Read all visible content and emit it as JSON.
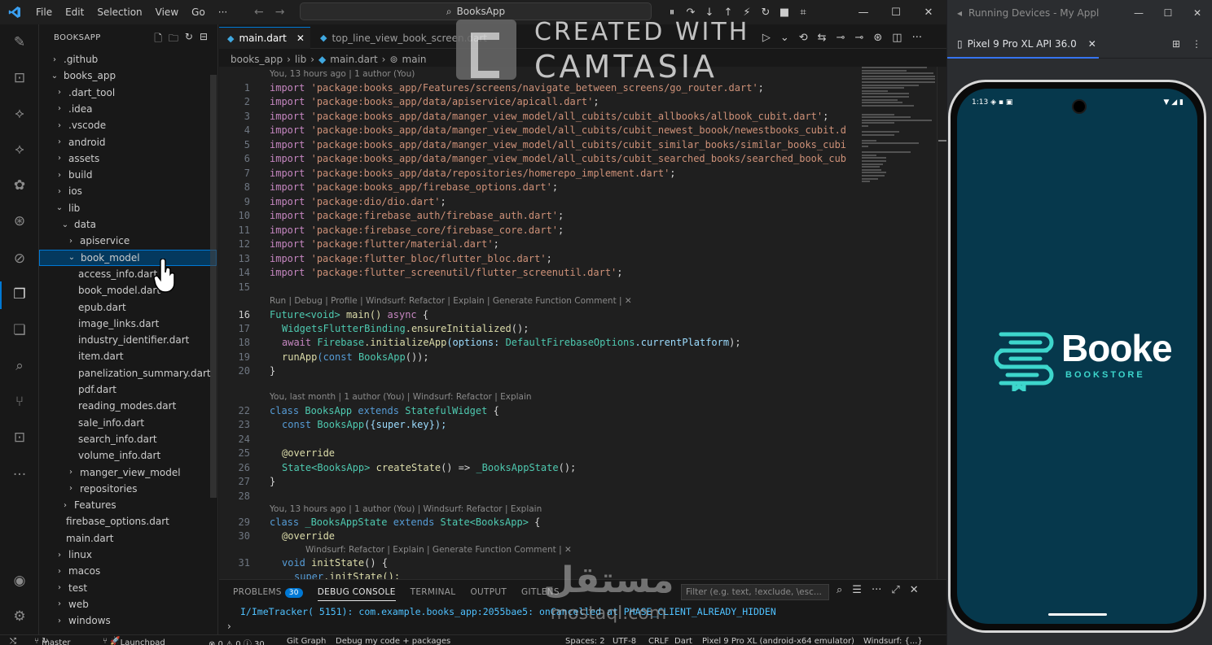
{
  "titlebar": {
    "menus": [
      "File",
      "Edit",
      "Selection",
      "View",
      "Go",
      "···"
    ],
    "search_text": "BooksApp"
  },
  "explorer": {
    "title": "BOOKSAPP",
    "items": [
      {
        "label": ".github",
        "level": 1,
        "chevron": "›"
      },
      {
        "label": "books_app",
        "level": 1,
        "chevron": "⌄"
      },
      {
        "label": ".dart_tool",
        "level": 2,
        "chevron": "›"
      },
      {
        "label": ".idea",
        "level": 2,
        "chevron": "›"
      },
      {
        "label": ".vscode",
        "level": 2,
        "chevron": "›"
      },
      {
        "label": "android",
        "level": 2,
        "chevron": "›"
      },
      {
        "label": "assets",
        "level": 2,
        "chevron": "›"
      },
      {
        "label": "build",
        "level": 2,
        "chevron": "›"
      },
      {
        "label": "ios",
        "level": 2,
        "chevron": "›"
      },
      {
        "label": "lib",
        "level": 2,
        "chevron": "⌄"
      },
      {
        "label": "data",
        "level": 3,
        "chevron": "⌄"
      },
      {
        "label": "apiservice",
        "level": 4,
        "chevron": "›"
      },
      {
        "label": "book_model",
        "level": 4,
        "chevron": "⌄",
        "selected": true
      },
      {
        "label": "access_info.dart",
        "level": 5,
        "chevron": ""
      },
      {
        "label": "book_model.dart",
        "level": 5,
        "chevron": ""
      },
      {
        "label": "epub.dart",
        "level": 5,
        "chevron": ""
      },
      {
        "label": "image_links.dart",
        "level": 5,
        "chevron": ""
      },
      {
        "label": "industry_identifier.dart",
        "level": 5,
        "chevron": ""
      },
      {
        "label": "item.dart",
        "level": 5,
        "chevron": ""
      },
      {
        "label": "panelization_summary.dart",
        "level": 5,
        "chevron": ""
      },
      {
        "label": "pdf.dart",
        "level": 5,
        "chevron": ""
      },
      {
        "label": "reading_modes.dart",
        "level": 5,
        "chevron": ""
      },
      {
        "label": "sale_info.dart",
        "level": 5,
        "chevron": ""
      },
      {
        "label": "search_info.dart",
        "level": 5,
        "chevron": ""
      },
      {
        "label": "volume_info.dart",
        "level": 5,
        "chevron": ""
      },
      {
        "label": "manger_view_model",
        "level": 4,
        "chevron": "›"
      },
      {
        "label": "repositories",
        "level": 4,
        "chevron": "›"
      },
      {
        "label": "Features",
        "level": 3,
        "chevron": "›"
      },
      {
        "label": "firebase_options.dart",
        "level": 3,
        "chevron": ""
      },
      {
        "label": "main.dart",
        "level": 3,
        "chevron": ""
      },
      {
        "label": "linux",
        "level": 2,
        "chevron": "›"
      },
      {
        "label": "macos",
        "level": 2,
        "chevron": "›"
      },
      {
        "label": "test",
        "level": 2,
        "chevron": "›"
      },
      {
        "label": "web",
        "level": 2,
        "chevron": "›"
      },
      {
        "label": "windows",
        "level": 2,
        "chevron": "›"
      }
    ]
  },
  "tabs": [
    {
      "label": "main.dart",
      "active": true
    },
    {
      "label": "top_line_view_book_screen.dart",
      "active": false
    }
  ],
  "breadcrumb": [
    "books_app",
    "lib",
    "main.dart",
    "main"
  ],
  "editor": {
    "lens_top": "You, 13 hours ago | 1 author (You)",
    "lens_main": "Run | Debug | Profile | Windsurf: Refactor | Explain | Generate Function Comment | ✕",
    "lens_class": "You, last month | 1 author (You) | Windsurf: Refactor | Explain",
    "lens_state": "You, 13 hours ago | 1 author (You) | Windsurf: Refactor | Explain",
    "lens_init": "Windsurf: Refactor | Explain | Generate Function Comment | ✕",
    "lines": [
      {
        "n": "1",
        "pkg": "'package:books_app/Features/screens/navigate_between_screens/go_router.dart'"
      },
      {
        "n": "2",
        "pkg": "'package:books_app/data/apiservice/apicall.dart'"
      },
      {
        "n": "3",
        "pkg": "'package:books_app/data/manger_view_model/all_cubits/cubit_allbooks/allbook_cubit.dart'"
      },
      {
        "n": "4",
        "pkg": "'package:books_app/data/manger_view_model/all_cubits/cubit_newest_boook/newestbooks_cubit.d"
      },
      {
        "n": "5",
        "pkg": "'package:books_app/data/manger_view_model/all_cubits/cubit_similar_books/similar_books_cubi"
      },
      {
        "n": "6",
        "pkg": "'package:books_app/data/manger_view_model/all_cubits/cubit_searched_books/searched_book_cub"
      },
      {
        "n": "7",
        "pkg": "'package:books_app/data/repositories/homerepo_implement.dart'"
      },
      {
        "n": "8",
        "pkg": "'package:books_app/firebase_options.dart'"
      },
      {
        "n": "9",
        "pkg": "'package:dio/dio.dart'"
      },
      {
        "n": "10",
        "pkg": "'package:firebase_auth/firebase_auth.dart'"
      },
      {
        "n": "11",
        "pkg": "'package:firebase_core/firebase_core.dart'"
      },
      {
        "n": "12",
        "pkg": "'package:flutter/material.dart'"
      },
      {
        "n": "13",
        "pkg": "'package:flutter_bloc/flutter_bloc.dart'"
      },
      {
        "n": "14",
        "pkg": "'package:flutter_screenutil/flutter_screenutil.dart'"
      }
    ],
    "kw_import": "import",
    "n15": "15",
    "n16": "16",
    "n17": "17",
    "n18": "18",
    "n19": "19",
    "n20": "20",
    "n22": "22",
    "n23": "23",
    "n24": "24",
    "n25": "25",
    "n26": "26",
    "n27": "27",
    "n28": "28",
    "n29": "29",
    "n30": "30",
    "n31": "31",
    "t_future": "Future",
    "t_void": "<void>",
    "t_main": " main() ",
    "t_async": "async",
    "t_brace": " {",
    "t_wfb": "WidgetsFlutterBinding",
    "t_ensure": ".ensureInitialized",
    "t_paren_semi": "();",
    "t_await": "await ",
    "t_firebase": "Firebase",
    "t_init_app": ".initializeApp",
    "t_options": "(options: ",
    "t_dfo": "DefaultFirebaseOptions",
    "t_current": ".currentPlatform",
    "t_close": ");",
    "t_runapp": "runApp",
    "t_const": "(const ",
    "t_booksapp": "BooksApp",
    "t_runclose": "());",
    "t_rbrace": "}",
    "t_class": "class ",
    "t_extends": " extends ",
    "t_stateful": "StatefulWidget",
    "t_const2": "const ",
    "t_ctor": "({super.key});",
    "t_override": "@override",
    "t_state": "State",
    "t_lt_booksapp": "<BooksApp>",
    "t_create": " createState",
    "t_arrow": "() => ",
    "t_bstate": "_BooksAppState",
    "t_semi_call": "();",
    "t_void2": "void ",
    "t_initstate": "initState",
    "t_paren_brace": "() {",
    "t_super": "super",
    "t_super_init": ".initState();"
  },
  "panel": {
    "tabs": [
      "PROBLEMS",
      "DEBUG CONSOLE",
      "TERMINAL",
      "OUTPUT",
      "GITLENS"
    ],
    "problems_count": "30",
    "filter_placeholder": "Filter (e.g. text, !exclude, \\esc...",
    "console_line": "I/ImeTracker( 5151): com.example.books_app:2055bae5: onCancelled at PHASE_CLIENT_ALREADY_HIDDEN",
    "prompt": "›"
  },
  "statusbar": {
    "branch": "master",
    "launchpad": "Launchpad",
    "problems": "⊗ 0 ⚠ 0 ⓘ 30",
    "git_graph": "Git Graph",
    "debug": "Debug my code + packages",
    "spaces": "Spaces: 2",
    "encoding": "UTF-8",
    "eol": "CRLF",
    "lang": "Dart",
    "device": "Pixel 9 Pro XL (android-x64 emulator)",
    "windsurf": "Windsurf: {...}"
  },
  "running_devices": {
    "title": "Running Devices - My Appl",
    "tab": "Pixel 9 Pro XL API 36.0",
    "phone_time": "1:13",
    "brand_name": "Booke",
    "brand_sub": "BOOKSTORE"
  },
  "watermarks": {
    "camtasia_line1": "CREATED WITH",
    "camtasia_line2": "CAMTASIA",
    "mostaql_ar": "مستقل",
    "mostaql_lat": "mostaql.com"
  },
  "colors": {
    "accent": "#0078d4",
    "phone_bg": "#06384c",
    "brand_teal": "#3dd6cc"
  }
}
